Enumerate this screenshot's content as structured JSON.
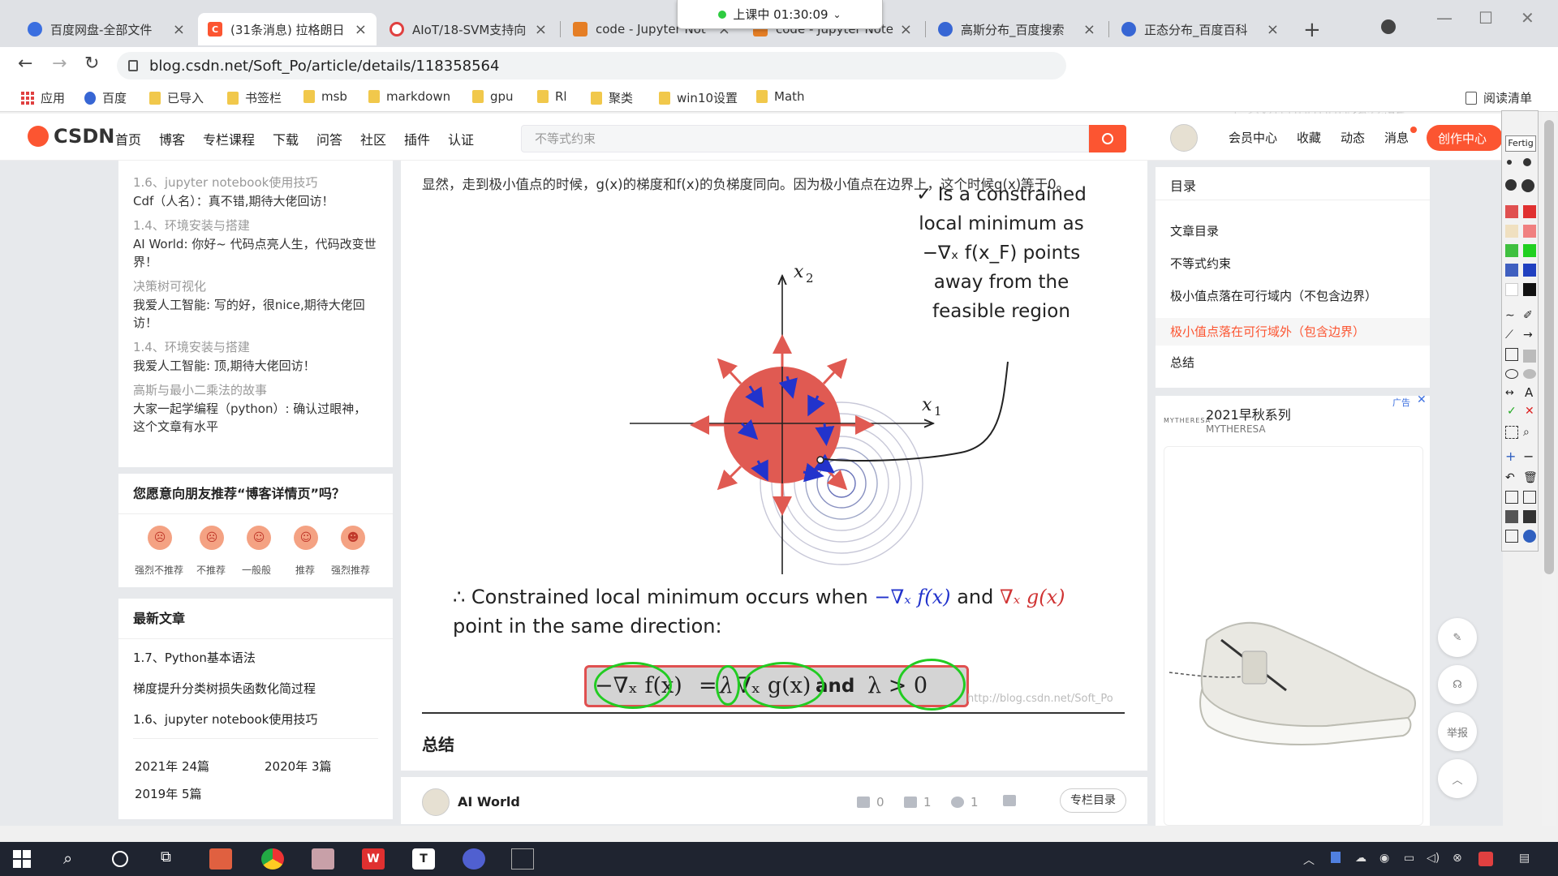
{
  "browser": {
    "tabs": [
      {
        "title": "百度网盘-全部文件",
        "icon_color": "#3b6fe0"
      },
      {
        "title": "(31条消息) 拉格朗日",
        "icon_color": "#fc5531"
      },
      {
        "title": "AIoT/18-SVM支持向",
        "icon_color": "#e04040"
      },
      {
        "title": "code - Jupyter Not",
        "icon_color": "#e57e25"
      },
      {
        "title": "code - Jupyter Note",
        "icon_color": "#e57e25"
      },
      {
        "title": "高斯分布_百度搜索",
        "icon_color": "#3766d4"
      },
      {
        "title": "正态分布_百度百科",
        "icon_color": "#3766d4"
      }
    ],
    "new_tab": "+",
    "live_status": "上课中 01:30:09",
    "url": "blog.csdn.net/Soft_Po/article/details/118358564",
    "watermark": "Python教程",
    "bookmarks": [
      "应用",
      "百度",
      "已导入",
      "书签栏",
      "msb",
      "markdown",
      "gpu",
      "Rl",
      "聚类",
      "win10设置",
      "Math"
    ],
    "reading_list": "阅读清单"
  },
  "csdn": {
    "logo": "CSDN",
    "nav": [
      "首页",
      "博客",
      "专栏课程",
      "下载",
      "问答",
      "社区",
      "插件",
      "认证"
    ],
    "search_placeholder": "不等式约束",
    "right_nav": [
      "会员中心",
      "收藏",
      "动态",
      "消息"
    ],
    "create_button": "创作中心"
  },
  "left": {
    "comments": [
      {
        "title": "1.6、jupyter notebook使用技巧",
        "body": "Cdf（人名）：真不错,期待大佬回访！"
      },
      {
        "title": "1.4、环境安装与搭建",
        "body": "AI World: 你好~ 代码点亮人生，代码改变世界！"
      },
      {
        "title": "决策树可视化",
        "body": "我爱人工智能: 写的好，很nice,期待大佬回访！"
      },
      {
        "title": "1.4、环境安装与搭建",
        "body": "我爱人工智能: 顶,期待大佬回访！"
      },
      {
        "title": "高斯与最小二乘法的故事",
        "body": "大家一起学编程（python）: 确认过眼神，这个文章有水平"
      }
    ],
    "recommend_title": "您愿意向朋友推荐“博客详情页”吗？",
    "ratings": [
      "强烈不推荐",
      "不推荐",
      "一般般",
      "推荐",
      "强烈推荐"
    ],
    "latest_title": "最新文章",
    "latest": [
      "1.7、Python基本语法",
      "梯度提升分类树损失函数化简过程",
      "1.6、jupyter notebook使用技巧"
    ],
    "archive": [
      "2021年 24篇",
      "2020年 3篇",
      "2019年 5篇"
    ]
  },
  "article": {
    "intro": "显然，走到极小值点的时候，g(x)的梯度和f(x)的负梯度同向。因为极小值点在边界上，这个时候g(x)等于0。",
    "figure": {
      "axis_x": "x",
      "axis_x_sub": "1",
      "axis_y": "x",
      "axis_y_sub": "2",
      "caption_lines": [
        "✓ Is a constrained",
        "local minimum as",
        "−∇ₓ f(x_F) points",
        "away from the",
        "feasible region"
      ],
      "colors": {
        "feasible_region": "#e05a52",
        "red_arrows": "#e05a52",
        "blue_arrows": "#2233cc",
        "contours": "#c8c8d8"
      }
    },
    "conclusion_prefix": "∴ Constrained local minimum occurs when",
    "conclusion_neg_grad_f": "−∇ₓ f(x)",
    "conclusion_and": "and",
    "conclusion_grad_g": "∇ₓ g(x)",
    "conclusion_line2": "point in the same direction:",
    "equation": {
      "lhs": "−∇ₓ f(x)",
      "eq": "=",
      "lambda": "λ",
      "grad_g": "∇ₓ g(x)",
      "and": "and",
      "condition": "λ > 0",
      "watermark": "http://blog.csdn.net/Soft_Po"
    },
    "summary_heading": "总结",
    "author": "AI World",
    "likes": "0",
    "comments": "1",
    "favorites": "1",
    "column_dir_button": "专栏目录"
  },
  "toc": {
    "title": "目录",
    "items": [
      "文章目录",
      "不等式约束",
      "极小值点落在可行域内（不包含边界）",
      "极小值点落在可行域外（包含边界）",
      "总结"
    ],
    "active_index": 3
  },
  "ad": {
    "ad_label": "广告",
    "brand_logo": "MYTHERESA",
    "title": "2021早秋系列",
    "subtitle": "MYTHERESA"
  },
  "floating": {
    "report": "举报"
  },
  "annotation_tool": {
    "done": "Fertig"
  }
}
